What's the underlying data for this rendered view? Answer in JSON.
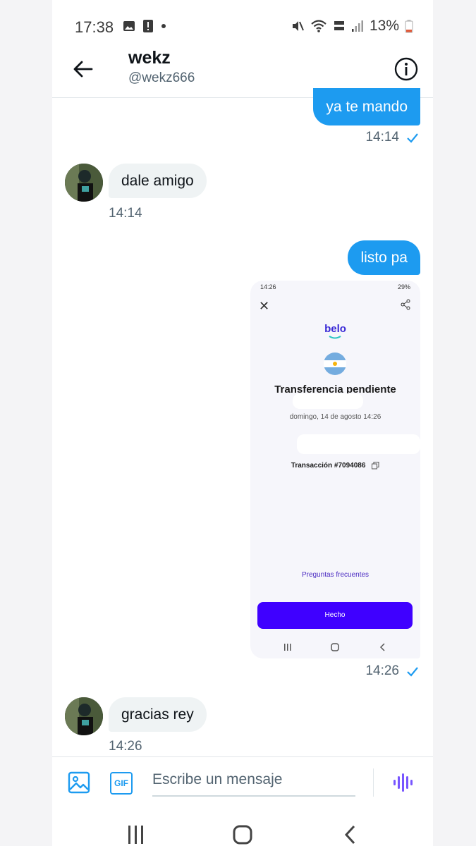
{
  "status_bar": {
    "time": "17:38",
    "battery": "13%"
  },
  "header": {
    "name": "wekz",
    "handle": "@wekz666"
  },
  "messages": [
    {
      "direction": "out",
      "text": "ya te mando",
      "time": "14:14"
    },
    {
      "direction": "in",
      "text": "dale amigo",
      "time": "14:14"
    },
    {
      "direction": "out",
      "text": "listo pa"
    },
    {
      "direction": "out",
      "attachment": "screenshot",
      "time": "14:26"
    },
    {
      "direction": "in",
      "text": "gracias rey",
      "time": "14:26"
    }
  ],
  "attachment": {
    "status_time": "14:26",
    "status_battery": "29%",
    "brand": "belo",
    "heading": "Transferencia pendiente",
    "date_text": "domingo, 14 de agosto 14:26",
    "transaction": "Transacción #7094086",
    "faq": "Preguntas frecuentes",
    "done_button": "Hecho"
  },
  "composer": {
    "placeholder": "Escribe un mensaje",
    "gif_label": "GIF"
  },
  "colors": {
    "accent": "#1d9bf0",
    "voice_icon": "#7856ff",
    "belo_button": "#3f00ff"
  }
}
